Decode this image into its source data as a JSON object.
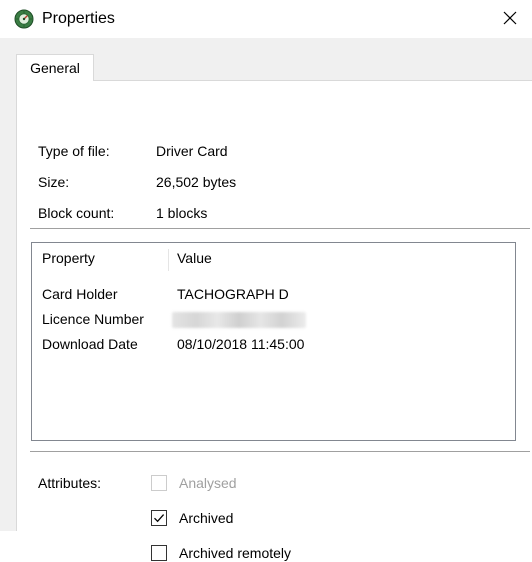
{
  "window": {
    "title": "Properties",
    "close_glyph": "✕"
  },
  "tabs": [
    {
      "label": "General",
      "selected": true
    }
  ],
  "info": {
    "type_label": "Type of file:",
    "type_value": "Driver Card",
    "size_label": "Size:",
    "size_value": "26,502 bytes",
    "block_label": "Block count:",
    "block_value": "1 blocks"
  },
  "properties": {
    "columns": [
      "Property",
      "Value"
    ],
    "rows": [
      {
        "property": "Card Holder",
        "value": "TACHOGRAPH D",
        "redacted": false
      },
      {
        "property": "Licence Number",
        "value": "",
        "redacted": true
      },
      {
        "property": "Download Date",
        "value": "08/10/2018 11:45:00",
        "redacted": false
      }
    ]
  },
  "attributes": {
    "label": "Attributes:",
    "items": [
      {
        "label": "Analysed",
        "checked": false,
        "enabled": false
      },
      {
        "label": "Archived",
        "checked": true,
        "enabled": true
      },
      {
        "label": "Archived remotely",
        "checked": false,
        "enabled": true
      }
    ]
  },
  "colors": {
    "dialog_bg": "#f0f0f0",
    "panel_bg": "#ffffff",
    "border": "#828790",
    "disabled_text": "#a0a0a0"
  },
  "icons": {
    "app": "tachograph-app-icon",
    "close": "close-icon",
    "check": "checkmark-icon"
  }
}
